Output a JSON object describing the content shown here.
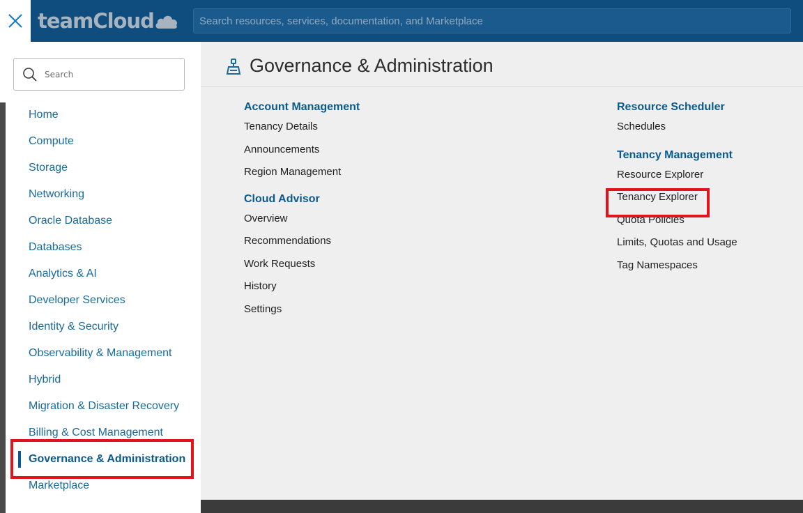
{
  "header": {
    "brand": "teamCloud",
    "search_placeholder": "Search resources, services, documentation, and Marketplace"
  },
  "sidebar": {
    "search_placeholder": "Search",
    "items": [
      {
        "label": "Home"
      },
      {
        "label": "Compute"
      },
      {
        "label": "Storage"
      },
      {
        "label": "Networking"
      },
      {
        "label": "Oracle Database"
      },
      {
        "label": "Databases"
      },
      {
        "label": "Analytics & AI"
      },
      {
        "label": "Developer Services"
      },
      {
        "label": "Identity & Security"
      },
      {
        "label": "Observability & Management"
      },
      {
        "label": "Hybrid"
      },
      {
        "label": "Migration & Disaster Recovery"
      },
      {
        "label": "Billing & Cost Management"
      },
      {
        "label": "Governance & Administration",
        "active": true
      },
      {
        "label": "Marketplace"
      }
    ]
  },
  "main": {
    "title": "Governance & Administration",
    "left_groups": [
      {
        "title": "Account Management",
        "links": [
          "Tenancy Details",
          "Announcements",
          "Region Management"
        ]
      },
      {
        "title": "Cloud Advisor",
        "links": [
          "Overview",
          "Recommendations",
          "Work Requests",
          "History",
          "Settings"
        ]
      }
    ],
    "right_groups": [
      {
        "title": "Resource Scheduler",
        "links": [
          "Schedules"
        ]
      },
      {
        "title": "Tenancy Management",
        "links": [
          "Resource Explorer",
          "Tenancy Explorer",
          "Quota Policies",
          "Limits, Quotas and Usage",
          "Tag Namespaces"
        ]
      }
    ]
  },
  "colors": {
    "topbar": "#0e4d7e",
    "accent": "#0b5a8b",
    "highlight": "#e0141a"
  }
}
